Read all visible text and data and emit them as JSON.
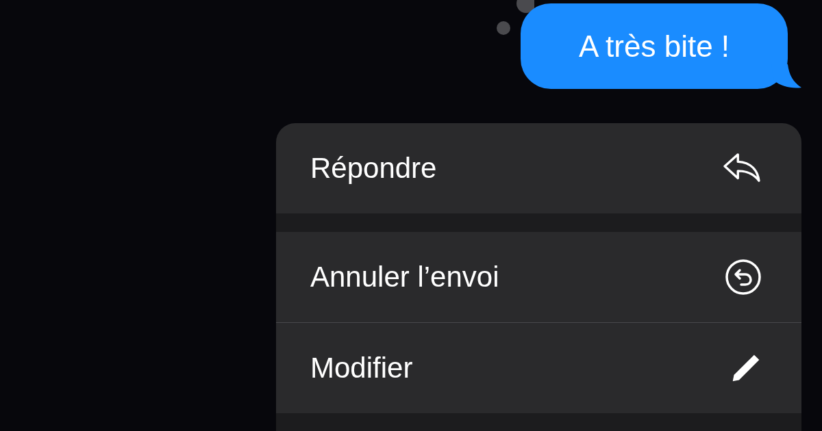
{
  "message": {
    "text": "A très bite !"
  },
  "menu": {
    "sections": [
      {
        "items": [
          {
            "label": "Répondre",
            "kind": "reply"
          }
        ]
      },
      {
        "items": [
          {
            "label": "Annuler l’envoi",
            "kind": "undo"
          },
          {
            "label": "Modifier",
            "kind": "edit"
          }
        ]
      }
    ]
  }
}
